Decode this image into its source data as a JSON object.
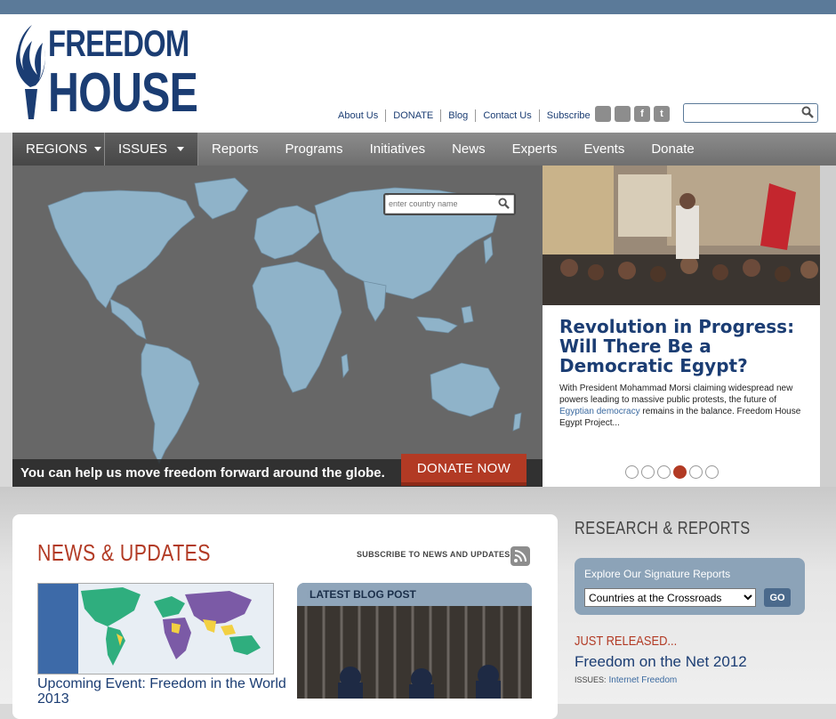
{
  "logo": {
    "line1": "FREEDOM",
    "line2": "HOUSE"
  },
  "top_links": [
    "About Us",
    "DONATE",
    "Blog",
    "Contact Us",
    "Subscribe"
  ],
  "social": [
    {
      "icon": "rss-icon",
      "glyph": ""
    },
    {
      "icon": "youtube-icon",
      "glyph": ""
    },
    {
      "icon": "facebook-icon",
      "glyph": "f"
    },
    {
      "icon": "twitter-icon",
      "glyph": "t"
    }
  ],
  "site_search": {
    "placeholder": "",
    "value": ""
  },
  "nav": {
    "regions": "REGIONS",
    "issues": "ISSUES",
    "links": [
      "Reports",
      "Programs",
      "Initiatives",
      "News",
      "Experts",
      "Events",
      "Donate"
    ]
  },
  "hero": {
    "country_search_placeholder": "enter country name",
    "message": "You can help us move freedom forward around the globe.",
    "donate_label": "DONATE NOW"
  },
  "feature": {
    "title": "Revolution in Progress: Will There Be a Democratic Egypt?",
    "body_before": "With President Mohammad Morsi claiming widespread new powers leading to massive public protests, the future of ",
    "body_link": "Egyptian democracy",
    "body_after": " remains in the balance. Freedom House Egypt Project...",
    "dots_total": 6,
    "dots_active": 4
  },
  "news": {
    "heading": "NEWS & UPDATES",
    "subscribe_label": "SUBSCRIBE TO NEWS AND UPDATES",
    "event_title": "Upcoming Event: Freedom in the World 2013",
    "blog_label": "LATEST BLOG POST"
  },
  "research": {
    "heading": "RESEARCH & REPORTS",
    "signature_title": "Explore Our Signature Reports",
    "select_value": "Countries at the Crossroads",
    "go_label": "GO",
    "just_released": "JUST RELEASED...",
    "report_title": "Freedom on the Net 2012",
    "issues_label": "ISSUES:",
    "issues_link": "Internet Freedom"
  },
  "colors": {
    "brand_blue": "#1b3d73",
    "accent_red": "#b23a24",
    "map_land": "#8fb3c9",
    "map_ocean": "#676767"
  }
}
